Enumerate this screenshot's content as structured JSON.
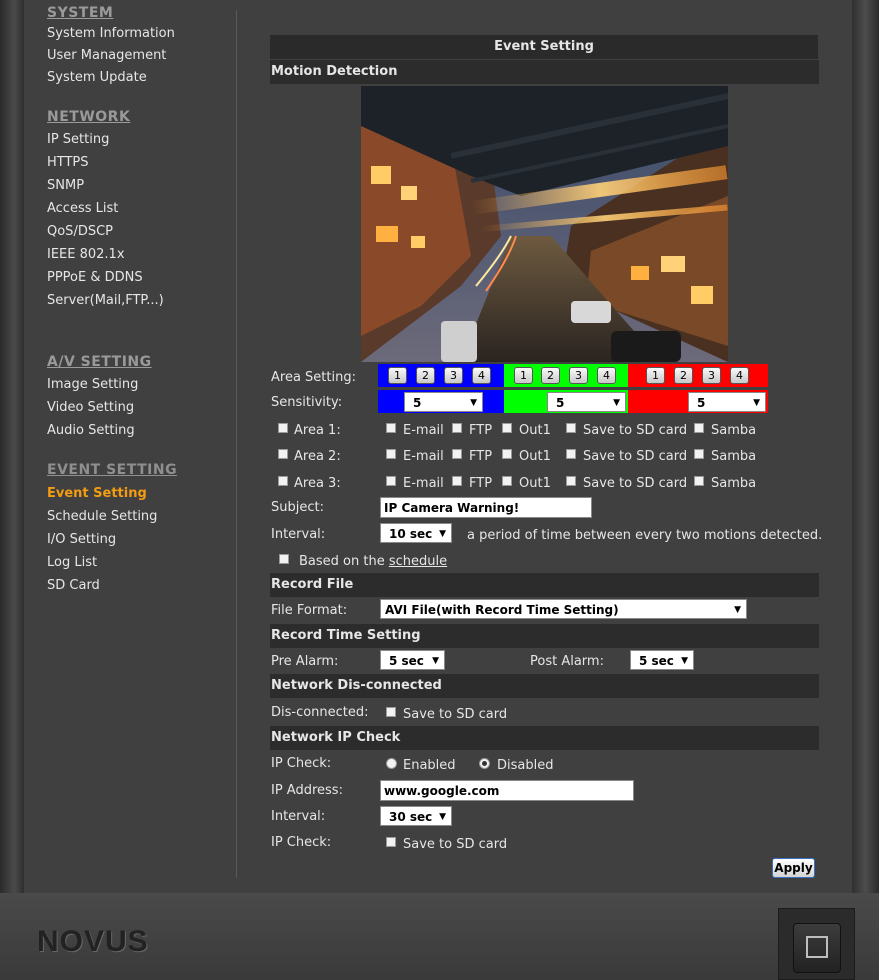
{
  "sidebar": {
    "system": {
      "title": "SYSTEM",
      "items": [
        "System Information",
        "User Management",
        "System Update"
      ]
    },
    "network": {
      "title": "NETWORK",
      "items": [
        "IP Setting",
        "HTTPS",
        "SNMP",
        "Access List",
        "QoS/DSCP",
        "IEEE 802.1x",
        "PPPoE & DDNS",
        "Server(Mail,FTP...)"
      ]
    },
    "av": {
      "title": "A/V SETTING",
      "items": [
        "Image Setting",
        "Video Setting",
        "Audio Setting"
      ]
    },
    "event": {
      "title": "EVENT SETTING",
      "items": [
        "Event Setting",
        "Schedule Setting",
        "I/O Setting",
        "Log List",
        "SD Card"
      ]
    }
  },
  "page_title": "Event Setting",
  "motion": {
    "header": "Motion Detection",
    "area_label": "Area Setting:",
    "area_buttons": [
      "1",
      "2",
      "3",
      "4"
    ],
    "area_colors": [
      "#0000ff",
      "#00ff00",
      "#ff0000"
    ],
    "sensitivity_label": "Sensitivity:",
    "sensitivity_values": [
      "5",
      "5",
      "5"
    ],
    "areas": [
      {
        "label": "Area 1:",
        "email": "E-mail",
        "ftp": "FTP",
        "out": "Out1",
        "sd": "Save to SD card",
        "samba": "Samba"
      },
      {
        "label": "Area 2:",
        "email": "E-mail",
        "ftp": "FTP",
        "out": "Out1",
        "sd": "Save to SD card",
        "samba": "Samba"
      },
      {
        "label": "Area 3:",
        "email": "E-mail",
        "ftp": "FTP",
        "out": "Out1",
        "sd": "Save to SD card",
        "samba": "Samba"
      }
    ],
    "subject_label": "Subject:",
    "subject_value": "IP Camera Warning!",
    "interval_label": "Interval:",
    "interval_value": "10 sec",
    "interval_note": "a period of time between every two motions detected.",
    "schedule_prefix": "Based on the",
    "schedule_link": "schedule"
  },
  "record_file": {
    "header": "Record File",
    "format_label": "File Format:",
    "format_value": "AVI File(with Record Time Setting)"
  },
  "record_time": {
    "header": "Record Time Setting",
    "pre_label": "Pre Alarm:",
    "pre_value": "5 sec",
    "post_label": "Post Alarm:",
    "post_value": "5 sec"
  },
  "disconnected": {
    "header": "Network Dis-connected",
    "label": "Dis-connected:",
    "sd": "Save to SD card"
  },
  "ipcheck": {
    "header": "Network IP Check",
    "check_label": "IP Check:",
    "enabled": "Enabled",
    "disabled": "Disabled",
    "selected": "Disabled",
    "address_label": "IP Address:",
    "address_value": "www.google.com",
    "interval_label": "Interval:",
    "interval_value": "30 sec",
    "check2_label": "IP Check:",
    "sd": "Save to SD card"
  },
  "apply_label": "Apply",
  "brand": "NOVUS"
}
